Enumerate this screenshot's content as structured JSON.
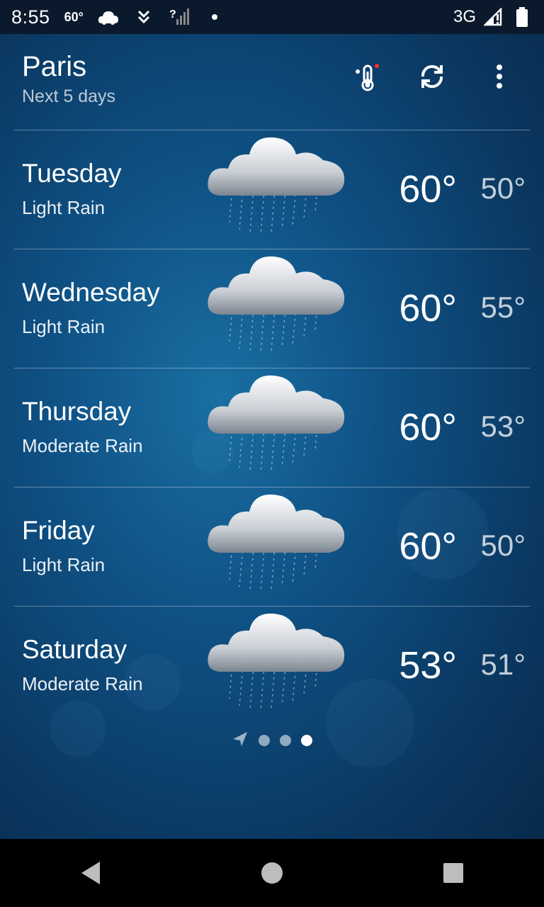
{
  "status_bar": {
    "time": "8:55",
    "temp": "60°",
    "network": "3G",
    "icons": [
      "weather-cloud-icon",
      "download-icon",
      "signal-unknown-icon",
      "notification-dot-icon",
      "mobile-signal-icon",
      "battery-icon"
    ]
  },
  "header": {
    "city": "Paris",
    "subtitle": "Next 5 days",
    "actions": [
      "thermometer-icon",
      "refresh-icon",
      "more-options-icon"
    ]
  },
  "forecast": [
    {
      "day": "Tuesday",
      "condition": "Light Rain",
      "high": "60°",
      "low": "50°",
      "icon": "rain-cloud-icon"
    },
    {
      "day": "Wednesday",
      "condition": "Light Rain",
      "high": "60°",
      "low": "55°",
      "icon": "rain-cloud-icon"
    },
    {
      "day": "Thursday",
      "condition": "Moderate Rain",
      "high": "60°",
      "low": "53°",
      "icon": "rain-cloud-icon"
    },
    {
      "day": "Friday",
      "condition": "Light Rain",
      "high": "60°",
      "low": "50°",
      "icon": "rain-cloud-icon"
    },
    {
      "day": "Saturday",
      "condition": "Moderate Rain",
      "high": "53°",
      "low": "51°",
      "icon": "rain-cloud-icon"
    }
  ],
  "pager": {
    "pages": 4,
    "active_index": 3,
    "first_icon": "location-arrow-icon"
  },
  "colors": {
    "accent_dot": "#ff2d2d",
    "background": "#0f5286"
  }
}
